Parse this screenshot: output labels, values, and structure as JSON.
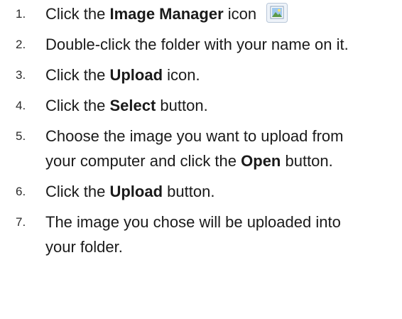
{
  "steps": [
    {
      "num": "1.",
      "parts": [
        {
          "t": "Click the "
        },
        {
          "b": "Image Manager"
        },
        {
          "t": " icon"
        }
      ],
      "icon": "image-manager-icon"
    },
    {
      "num": "2.",
      "parts": [
        {
          "t": "Double-click the folder with your name on it."
        }
      ]
    },
    {
      "num": "3.",
      "parts": [
        {
          "t": "Click the "
        },
        {
          "b": "Upload"
        },
        {
          "t": " icon."
        }
      ]
    },
    {
      "num": "4.",
      "parts": [
        {
          "t": "Click the "
        },
        {
          "b": "Select"
        },
        {
          "t": " button."
        }
      ]
    },
    {
      "num": "5.",
      "parts": [
        {
          "t": "Choose the image you want to upload from your computer and click the "
        },
        {
          "b": "Open"
        },
        {
          "t": " button."
        }
      ]
    },
    {
      "num": "6.",
      "parts": [
        {
          "t": "Click the "
        },
        {
          "b": "Upload"
        },
        {
          "t": " button."
        }
      ]
    },
    {
      "num": "7.",
      "parts": [
        {
          "t": "The image you chose will be uploaded into your folder."
        }
      ]
    }
  ]
}
